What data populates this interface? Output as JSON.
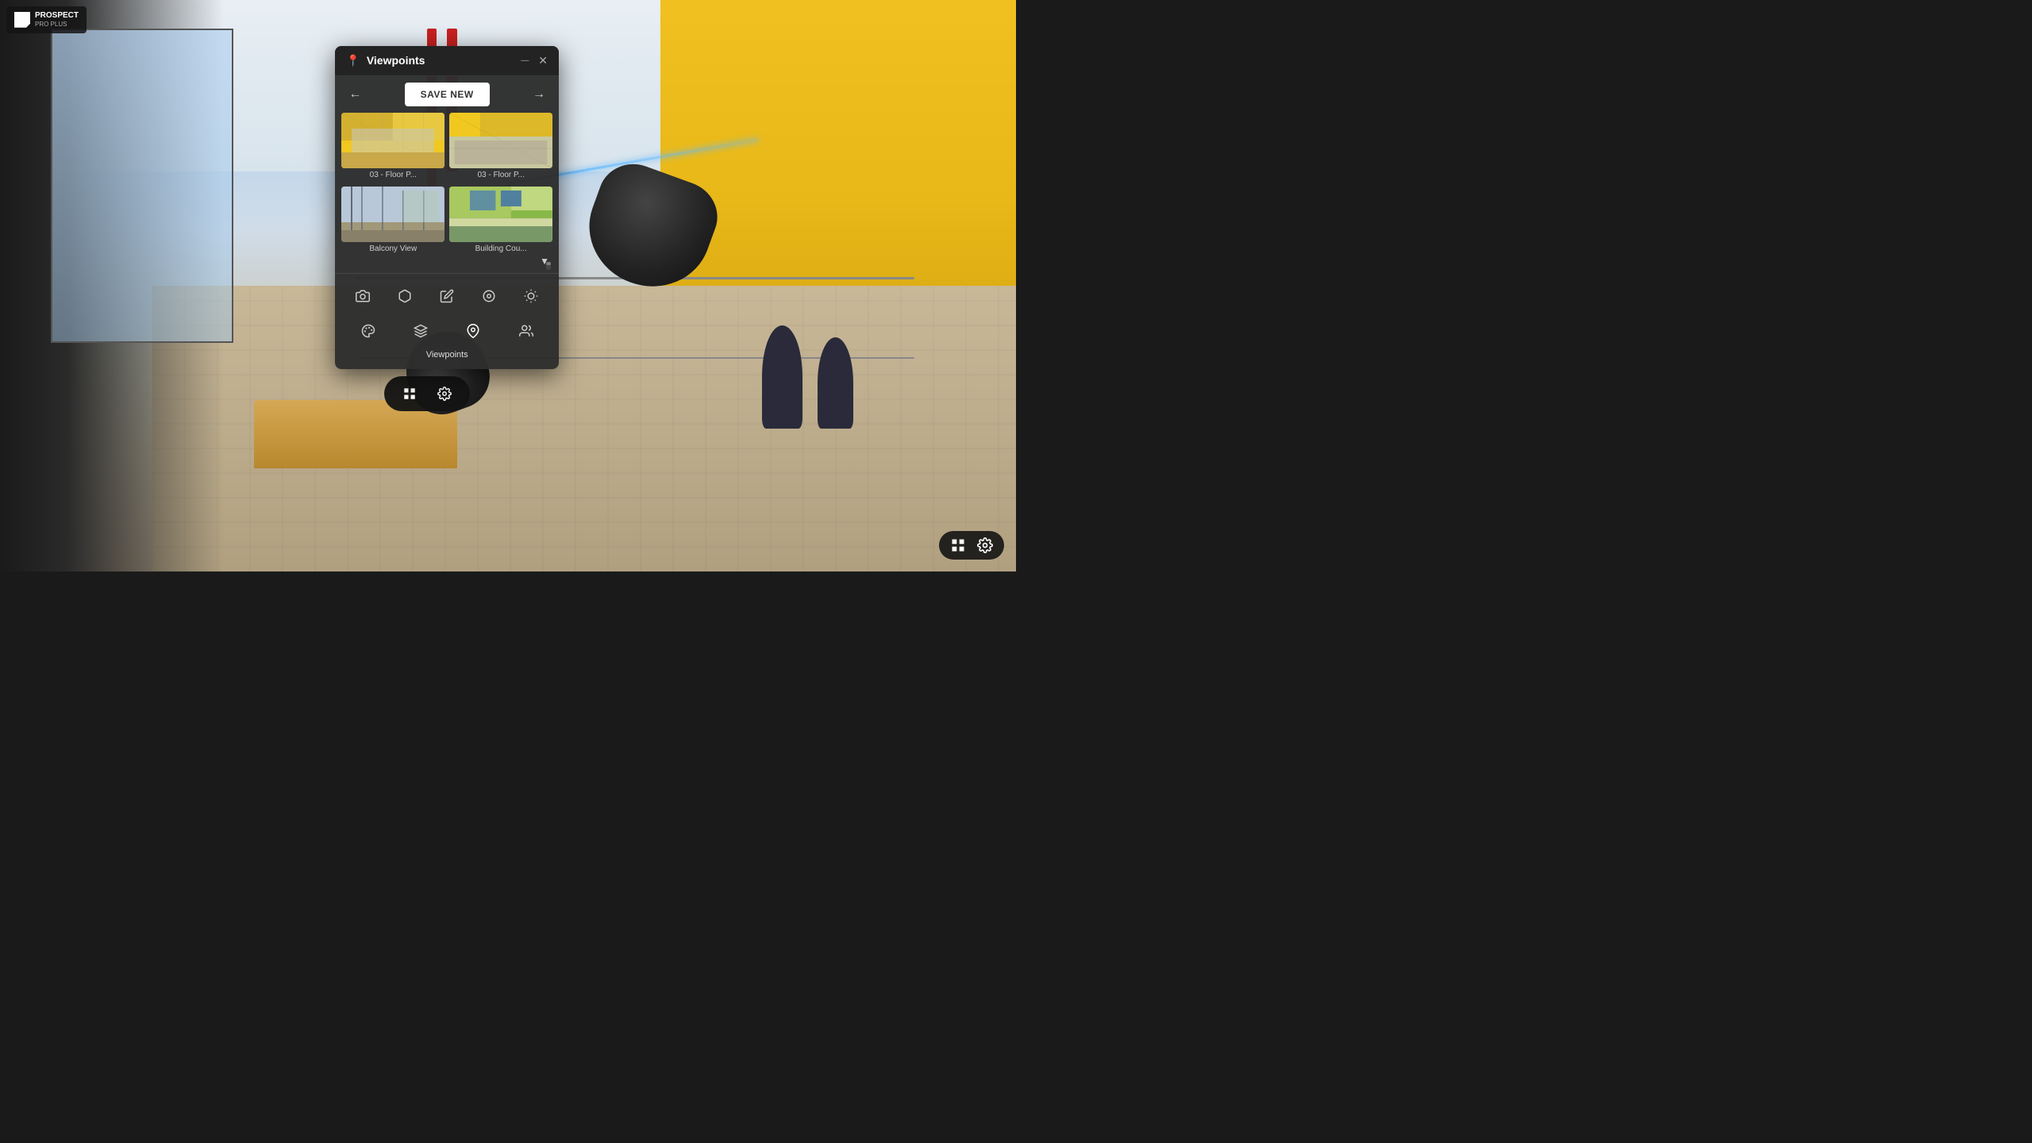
{
  "app": {
    "name": "PROSPECT",
    "subtitle": "PRO PLUS"
  },
  "panel": {
    "title": "Viewpoints",
    "save_new_label": "SAVE NEW",
    "viewpoints": [
      {
        "id": "vp1",
        "label": "03 - Floor P...",
        "thumb_type": "floor1"
      },
      {
        "id": "vp2",
        "label": "03 - Floor P...",
        "thumb_type": "floor2"
      },
      {
        "id": "vp3",
        "label": "Balcony View",
        "thumb_type": "balcony"
      },
      {
        "id": "vp4",
        "label": "Building Cou...",
        "thumb_type": "building"
      }
    ],
    "active_tool": "viewpoints",
    "tools_row1": [
      {
        "id": "camera",
        "icon": "📷",
        "label": "Camera"
      },
      {
        "id": "model",
        "icon": "⬡",
        "label": "Model"
      },
      {
        "id": "edit",
        "icon": "✏",
        "label": "Edit"
      },
      {
        "id": "measure",
        "icon": "◎",
        "label": "Measure"
      },
      {
        "id": "light",
        "icon": "☀",
        "label": "Light"
      }
    ],
    "tools_row2": [
      {
        "id": "palette",
        "icon": "🎨",
        "label": "Palette"
      },
      {
        "id": "layers",
        "icon": "⬡",
        "label": "Layers"
      },
      {
        "id": "viewpoints_tool",
        "icon": "📍",
        "label": "Viewpoints",
        "active": true
      },
      {
        "id": "people",
        "icon": "🚶",
        "label": "People"
      }
    ]
  },
  "bottom_bar": {
    "grid_icon": "⊞",
    "settings_icon": "⚙"
  },
  "float_bar": {
    "grid_icon": "⊞",
    "settings_icon": "⚙"
  }
}
